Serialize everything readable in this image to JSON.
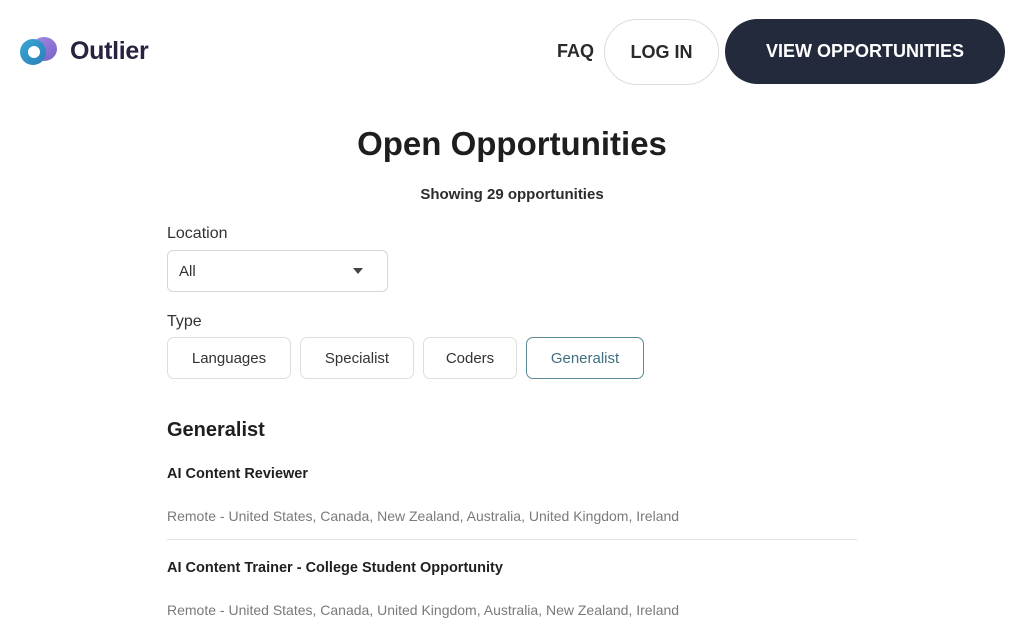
{
  "header": {
    "brand": "Outlier",
    "faq_label": "FAQ",
    "login_label": "LOG IN",
    "view_label": "VIEW OPPORTUNITIES",
    "brand_colors": {
      "mark_blue": "#3aa6d6",
      "mark_purple": "#7a5cc7",
      "text": "#2a2140"
    }
  },
  "main": {
    "title": "Open Opportunities",
    "count_text": "Showing 29 opportunities",
    "location": {
      "label": "Location",
      "value": "All"
    },
    "type": {
      "label": "Type",
      "options": [
        "Languages",
        "Specialist",
        "Coders",
        "Generalist"
      ],
      "selected": "Generalist"
    },
    "section_title": "Generalist",
    "jobs": [
      {
        "title": "AI Content Reviewer",
        "location": "Remote - United States, Canada, New Zealand, Australia, United Kingdom, Ireland"
      },
      {
        "title": "AI Content Trainer - College Student Opportunity",
        "location": "Remote - United States, Canada, United Kingdom, Australia, New Zealand, Ireland"
      }
    ]
  },
  "colors": {
    "primary_button": "#222a3b",
    "selected_chip_border": "#5b8a99"
  }
}
